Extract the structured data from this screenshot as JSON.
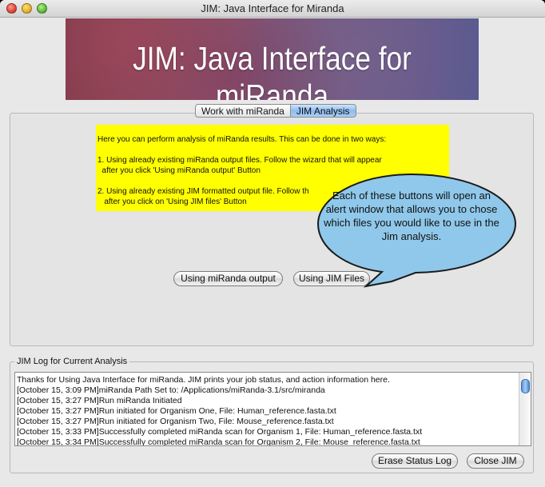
{
  "window": {
    "title": "JIM: Java Interface for Miranda"
  },
  "banner": {
    "text": "JIM: Java Interface for miRanda"
  },
  "tabs": [
    {
      "label": "Work with miRanda",
      "active": false
    },
    {
      "label": "JIM Analysis",
      "active": true
    }
  ],
  "analysis": {
    "instructions": "Here you can perform analysis of miRanda results. This can be done in two ways:\n\n1. Using already existing miRanda output files. Follow the wizard that will appear\n  after you click 'Using miRanda output' Button\n\n2. Using already existing JIM formatted output file. Follow th\n   after you click on 'Using JIM files' Button",
    "button_mirnada_output": "Using miRanda output",
    "button_jim_files": "Using JIM Files"
  },
  "callout": {
    "text": "Each of these buttons will open an alert window that allows you to chose which files you would like to use in the Jim analysis."
  },
  "log": {
    "title": "JIM Log for Current Analysis",
    "lines": [
      "Thanks for Using Java Interface for miRanda. JIM prints your job status, and action information here.",
      "[October 15, 3:09 PM]miRanda Path Set to: /Applications/miRanda-3.1/src/miranda",
      "[October 15, 3:27 PM]Run miRanda Initiated",
      "[October 15, 3:27 PM]Run initiated for Organism One, File: Human_reference.fasta.txt",
      "[October 15, 3:27 PM]Run initiated for Organism Two, File: Mouse_reference.fasta.txt",
      "[October 15, 3:33 PM]Successfully completed miRanda scan for Organism 1, File: Human_reference.fasta.txt",
      "[October 15, 3:34 PM]Successfully completed miRanda scan for Organism 2, File: Mouse_reference.fasta.txt"
    ]
  },
  "footer": {
    "erase_label": "Erase Status Log",
    "close_label": "Close JIM"
  },
  "colors": {
    "highlight": "#ffff00",
    "callout_fill": "#8fc8ea",
    "tab_active": "#8ebcf0"
  }
}
